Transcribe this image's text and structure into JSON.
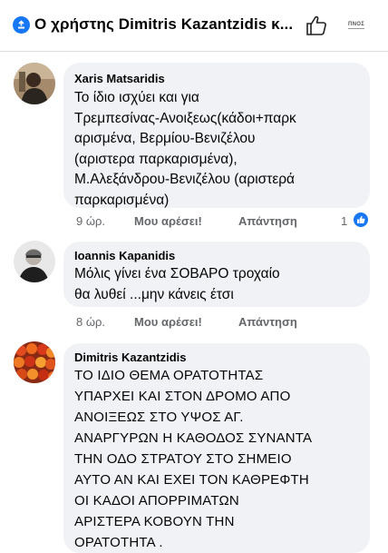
{
  "header": {
    "title": "Ο χρήστης Dimitris Kazantzidis κ...",
    "mini_label": "ΠΝΟΣ"
  },
  "comments": [
    {
      "author": "Xaris Matsaridis",
      "lines": [
        "Το ίδιο ισχύει και για",
        "Τρεμπεσίνας-Ανοιξεως(κάδοι+παρκ",
        "αρισμένα, Βερμίου-Βενιζέλου",
        "(αριστερα παρκαρισμένα),",
        "Μ.Αλεξάνδρου-Βενιζέλου (αριστερά",
        "παρκαρισμένα)"
      ],
      "time": "9 ώρ.",
      "like_label": "Μου αρέσει!",
      "reply_label": "Απάντηση",
      "reaction_count": "1"
    },
    {
      "author": "Ioannis Kapanidis",
      "lines": [
        "Μόλις γίνει  ένα ΣΟΒΑΡΟ τροχαίο",
        "θα λυθεί ...μην κάνεις έτσι"
      ],
      "time": "8 ώρ.",
      "like_label": "Μου αρέσει!",
      "reply_label": "Απάντηση"
    },
    {
      "author": "Dimitris Kazantzidis",
      "lines": [
        "ΤΟ ΙΔΙΟ ΘΕΜΑ ΟΡΑΤΟΤΗΤΑΣ",
        "ΥΠΑΡΧΕΙ ΚΑΙ ΣΤΟΝ ΔΡΟΜΟ ΑΠΟ",
        "ΑΝΟΙΞΕΩΣ ΣΤΟ ΥΨΟΣ ΑΓ.",
        "ΑΝΑΡΓΥΡΩΝ Η ΚΑΘΟΔΟΣ  ΣΥΝΑΝΤΑ",
        "ΤΗΝ ΟΔΟ ΣΤΡΑΤΟΥ ΣΤΟ ΣΗΜΕΙΟ",
        "ΑΥΤΟ ΑΝ ΚΑΙ ΕΧΕΙ ΤΟΝ ΚΑΘΡΕΦΤΗ",
        "ΟΙ ΚΑΔΟΙ ΑΠΟΡΡΙΜΑΤΩΝ",
        "ΑΡΙΣΤΕΡΑ ΚΟΒΟΥΝ ΤΗΝ",
        "ΟΡΑΤΟΤΗΤΑ ."
      ]
    }
  ],
  "colors": {
    "accent": "#1877f2",
    "bubble": "#f0f2f5",
    "meta_text": "#65676b"
  },
  "icons": [
    "info-badge-icon",
    "like-outline-icon",
    "like-reaction-icon"
  ]
}
